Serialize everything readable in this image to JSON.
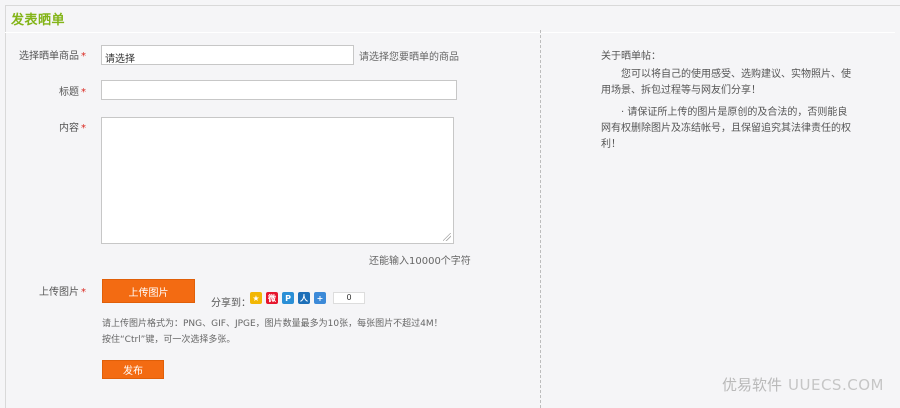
{
  "page": {
    "title": "发表晒单"
  },
  "form": {
    "product": {
      "label": "选择晒单商品",
      "required_mark": "*",
      "value": "请选择",
      "hint": "请选择您要晒单的商品"
    },
    "heading": {
      "label": "标题",
      "required_mark": "*",
      "value": ""
    },
    "content": {
      "label": "内容",
      "required_mark": "*",
      "value": "",
      "counter": "还能输入10000个字符"
    },
    "upload": {
      "label": "上传图片",
      "required_mark": "*",
      "button_label": "上传图片",
      "note_line1": "请上传图片格式为：PNG、GIF、JPGE，图片数量最多为10张，每张图片不超过4M！",
      "note_line2": "按住“Ctrl”键，可一次选择多张。"
    },
    "share": {
      "label": "分享到：",
      "icons": [
        {
          "name": "qzone-share-icon",
          "color": "#f2b705",
          "glyph": "★"
        },
        {
          "name": "weibo-share-icon",
          "color": "#e6162d",
          "glyph": "微"
        },
        {
          "name": "pengyou-share-icon",
          "color": "#2a8fd6",
          "glyph": "P"
        },
        {
          "name": "renren-share-icon",
          "color": "#1d6fb8",
          "glyph": "人"
        },
        {
          "name": "more-share-icon",
          "color": "#3c8ad8",
          "glyph": "+"
        }
      ],
      "count": "0"
    },
    "submit_label": "发布"
  },
  "sidebar": {
    "title": "关于晒单帖：",
    "paragraph1": "您可以将自己的使用感受、选购建议、实物照片、使用场景、拆包过程等与网友们分享！",
    "paragraph2": "· 请保证所上传的图片是原创的及合法的，否则能良网有权删除图片及冻结帐号，且保留追究其法律责任的权利！"
  },
  "watermark": {
    "brand": "优易软件",
    "domain": "UUECS.COM"
  }
}
